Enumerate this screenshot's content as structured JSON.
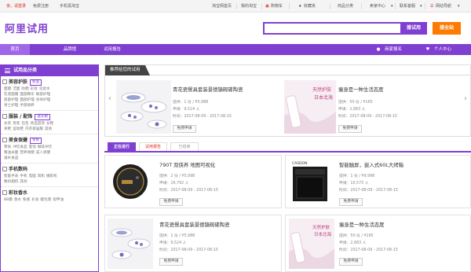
{
  "topbar": {
    "greeting": "亲，请登录",
    "register": "免费注册",
    "mobile": "手机逛淘宝",
    "links": [
      "淘宝网首页",
      "我的淘宝",
      "购物车",
      "收藏夹",
      "商品分类",
      "卖家中心",
      "联系客服",
      "网站导航"
    ],
    "accent_color": "#e0301e"
  },
  "header": {
    "logo": "阿里试用",
    "search_label": "搜试用",
    "hunt_label": "搜全站",
    "search_value": ""
  },
  "nav": {
    "items": [
      "首页",
      "品牌馆",
      "试用报告"
    ],
    "right": [
      "商家报名",
      "个人中心"
    ],
    "color": "#7f3fd1"
  },
  "sidebar": {
    "title": "试用品分类",
    "cats": [
      {
        "name": "美容护肤",
        "tag": "新品",
        "subs": [
          "面膜",
          "洁面",
          "防晒",
          "彩妆",
          "化妆水",
          "乳液面霜",
          "面部精华",
          "眼部护理",
          "唇部护理",
          "面部护理",
          "身体护理",
          "男士护理",
          "手部保养"
        ]
      },
      {
        "name": "服装 / 配饰",
        "tag": "送衣裙",
        "subs": [
          "女装",
          "男装",
          "包包",
          "饰品首饰",
          "女鞋",
          "男鞋",
          "运动鞋",
          "内衣家居服",
          "其他"
        ]
      },
      {
        "name": "美食保健",
        "tag": "零食",
        "subs": [
          "零食",
          "冲饮食品",
          "蜜饯",
          "咖啡冲饮",
          "粮油米面",
          "营养保健",
          "成人保健",
          "滋补食品"
        ]
      },
      {
        "name": "手机数码",
        "tag": "",
        "subs": [
          "智能手表",
          "手机",
          "电脑",
          "耳机",
          "摄影机",
          "数码相机",
          "其他"
        ]
      },
      {
        "name": "彩妆香水",
        "tag": "",
        "subs": [
          "BB霜",
          "香水",
          "粉底",
          "彩妆",
          "睫毛膏",
          "指甲油"
        ]
      }
    ]
  },
  "recommend": {
    "title": "推荐给您的试用",
    "items": [
      {
        "title": "青花瓷餐具套装景德镇碗碟陶瓷",
        "offer": "提供：1 份 / ¥5,988",
        "apply": "申请：9,524 人",
        "time": "时间：2017-08-09 - 2017-08-15",
        "button": "免费申请"
      },
      {
        "title": "瘦身是一种生活态度",
        "offer": "提供：50 份 / ¥165",
        "apply": "申请：2,683 人",
        "time": "时间：2017-08-09 - 2017-08-15",
        "button": "免费申请"
      }
    ]
  },
  "tabs": [
    "正在进行",
    "试用报告",
    "已结束"
  ],
  "grid": [
    {
      "title": "790T 双侠养 地图可视化",
      "offer": "提供：2 份 / ¥5,098",
      "apply": "申请：16,792 人",
      "time": "时间：2017-08-09 - 2017-08-15",
      "button": "免费申请"
    },
    {
      "title": "智能触屏，嵌入式60L大烤箱",
      "offer": "提供：1 份 / ¥9,998",
      "apply": "申请：10,573 人",
      "time": "时间：2017-08-09 - 2017-08-15",
      "button": "免费申请"
    },
    {
      "title": "青花瓷餐具套装景德镇碗碟陶瓷",
      "offer": "提供：1 份 / ¥5,988",
      "apply": "申请：9,524 人",
      "time": "时间：2017-08-09 - 2017-08-15",
      "button": "免费申请"
    },
    {
      "title": "瘦身是一种生活态度",
      "offer": "提供：50 份 / ¥165",
      "apply": "申请：2,683 人",
      "time": "时间：2017-08-09 - 2017-08-15",
      "button": "免费申请"
    }
  ],
  "product_art": {
    "cream_brand": "天然护肤",
    "cream_sub": "日本北海",
    "oven_brand": "CASDON"
  }
}
